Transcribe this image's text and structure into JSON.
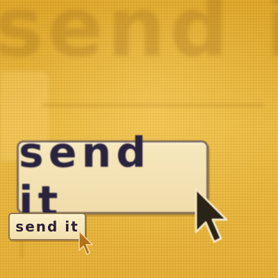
{
  "background_text": "send it",
  "buttons": {
    "large_label": "send it",
    "small_label": "send it"
  },
  "icons": {
    "cursor_large": "mouse-pointer-arrow",
    "cursor_small": "mouse-pointer-arrow"
  },
  "colors": {
    "background": "#e9b63a",
    "button_face": "#f6e8bd",
    "button_border": "#7d6a58",
    "label": "#2a2340",
    "cursor": "#2a2418"
  }
}
